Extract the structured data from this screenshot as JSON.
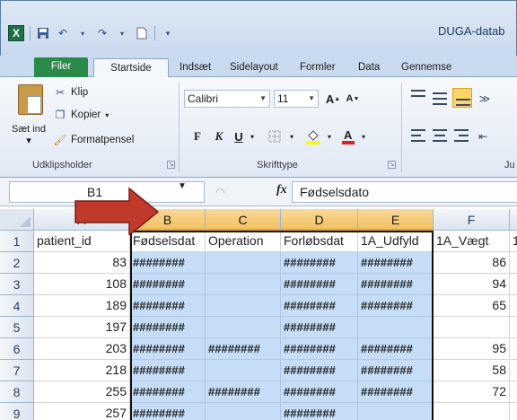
{
  "window": {
    "title": "DUGA-datab"
  },
  "tabs": [
    {
      "id": "file",
      "label": "Filer"
    },
    {
      "id": "home",
      "label": "Startside"
    },
    {
      "id": "insert",
      "label": "Indsæt"
    },
    {
      "id": "layout",
      "label": "Sidelayout"
    },
    {
      "id": "formulas",
      "label": "Formler"
    },
    {
      "id": "data",
      "label": "Data"
    },
    {
      "id": "review",
      "label": "Gennemse"
    }
  ],
  "ribbon": {
    "clipboard": {
      "paste_label": "Sæt ind",
      "paste_arrow": "▾",
      "cut_label": "Klip",
      "copy_label": "Kopier",
      "format_painter_label": "Formatpensel",
      "group_label": "Udklipsholder"
    },
    "font": {
      "font_name": "Calibri",
      "font_size": "11",
      "bold": "F",
      "italic": "K",
      "underline": "U",
      "group_label": "Skrifttype"
    },
    "alignment": {
      "group_label": "Ju"
    }
  },
  "formula_bar": {
    "name_box": "B1",
    "fx_label": "fx",
    "formula": "Fødselsdato"
  },
  "grid": {
    "columns": [
      "A",
      "B",
      "C",
      "D",
      "E",
      "F"
    ],
    "selected_columns": [
      "B",
      "C",
      "D",
      "E"
    ],
    "rows": [
      {
        "num": "1",
        "cells": [
          "patient_id",
          "Fødselsdat",
          "Operation",
          "Forløbsdat",
          "1A_Udfyld",
          "1A_Vægt"
        ],
        "extra": "1"
      },
      {
        "num": "2",
        "cells": [
          "83",
          "########",
          "",
          "########",
          "########",
          "86"
        ],
        "extra": ""
      },
      {
        "num": "3",
        "cells": [
          "108",
          "########",
          "",
          "########",
          "########",
          "94"
        ],
        "extra": ""
      },
      {
        "num": "4",
        "cells": [
          "189",
          "########",
          "",
          "########",
          "########",
          "65"
        ],
        "extra": ""
      },
      {
        "num": "5",
        "cells": [
          "197",
          "########",
          "",
          "########",
          "",
          ""
        ],
        "extra": ""
      },
      {
        "num": "6",
        "cells": [
          "203",
          "########",
          "########",
          "########",
          "########",
          "95"
        ],
        "extra": ""
      },
      {
        "num": "7",
        "cells": [
          "218",
          "########",
          "",
          "########",
          "########",
          "58"
        ],
        "extra": ""
      },
      {
        "num": "8",
        "cells": [
          "255",
          "########",
          "########",
          "########",
          "########",
          "72"
        ],
        "extra": ""
      },
      {
        "num": "9",
        "cells": [
          "257",
          "########",
          "",
          "########",
          "",
          ""
        ],
        "extra": ""
      }
    ]
  },
  "colors": {
    "selection_fill": "#c5ddf7",
    "annotation_arrow": "#c0392b",
    "file_tab": "#2a8a4a"
  }
}
